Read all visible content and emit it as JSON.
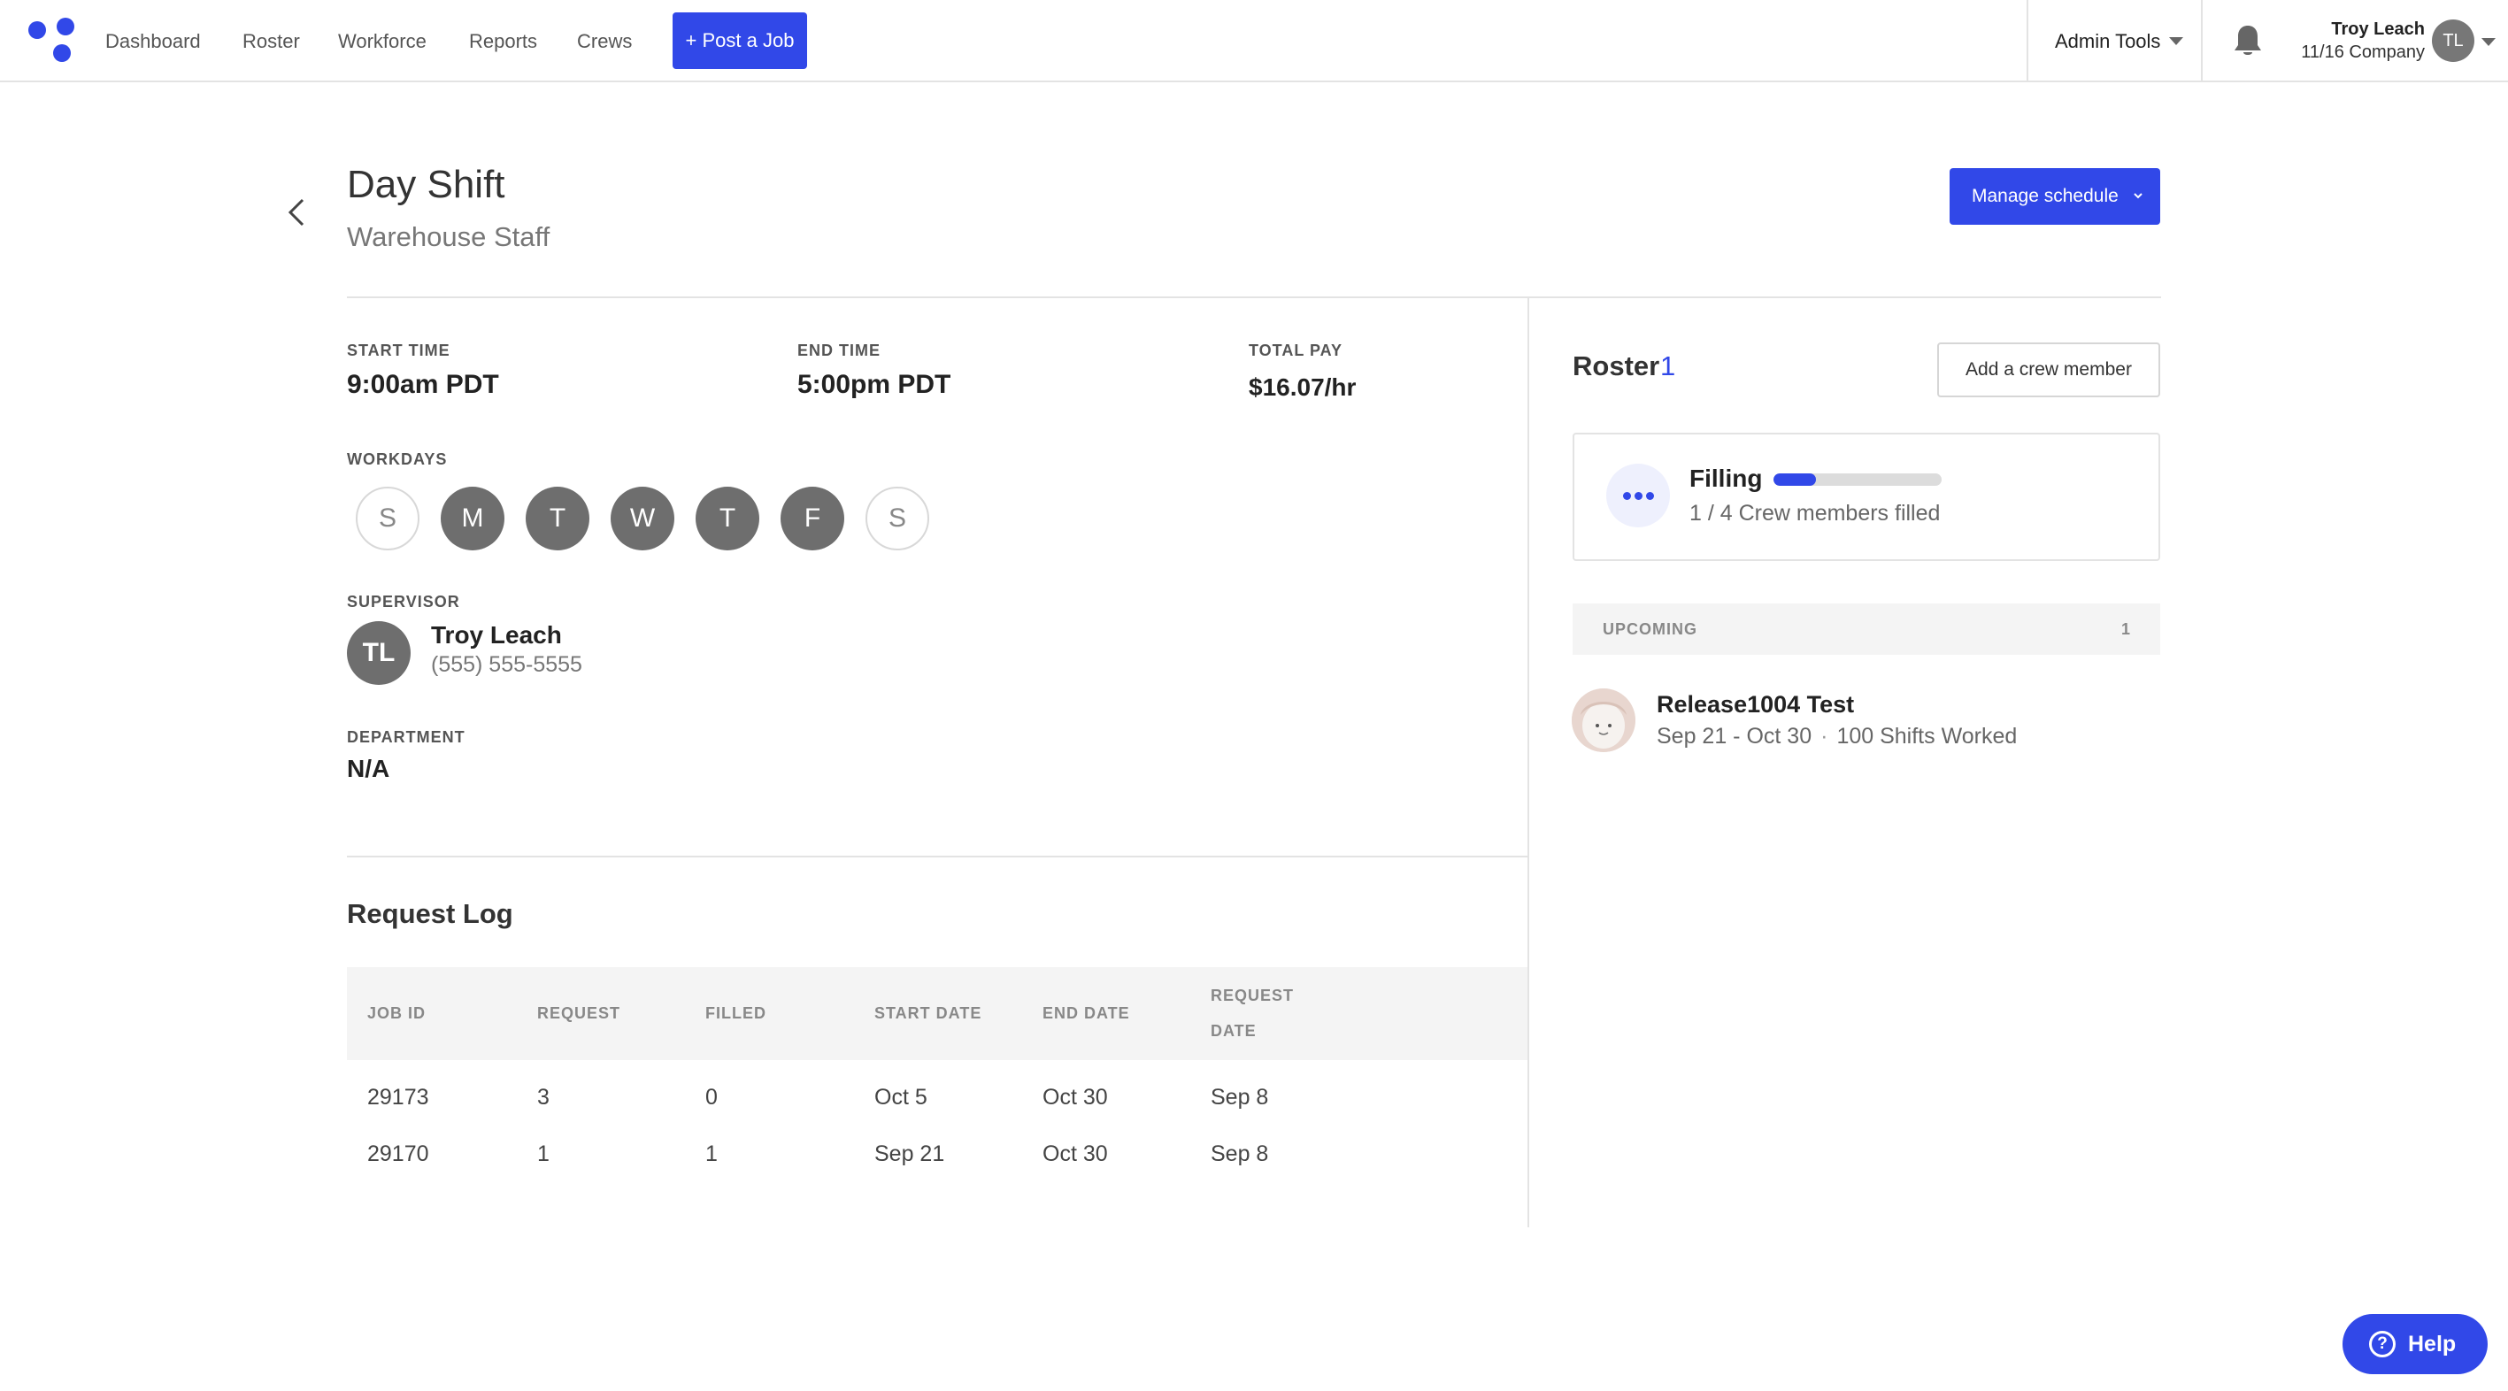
{
  "nav": {
    "links": [
      "Dashboard",
      "Roster",
      "Workforce",
      "Reports",
      "Crews"
    ],
    "post_job": "+ Post a Job",
    "admin_tools": "Admin Tools",
    "user_name": "Troy Leach",
    "user_company": "11/16 Company",
    "user_initials": "TL"
  },
  "header": {
    "title": "Day Shift",
    "subtitle": "Warehouse Staff",
    "manage_schedule": "Manage schedule"
  },
  "details": {
    "start_time_label": "START TIME",
    "start_time": "9:00am PDT",
    "end_time_label": "END TIME",
    "end_time": "5:00pm PDT",
    "total_pay_label": "TOTAL PAY",
    "total_pay": "$16.07/hr",
    "workdays_label": "WORKDAYS",
    "workdays": [
      {
        "letter": "S",
        "active": false
      },
      {
        "letter": "M",
        "active": true
      },
      {
        "letter": "T",
        "active": true
      },
      {
        "letter": "W",
        "active": true
      },
      {
        "letter": "T",
        "active": true
      },
      {
        "letter": "F",
        "active": true
      },
      {
        "letter": "S",
        "active": false
      }
    ],
    "supervisor_label": "SUPERVISOR",
    "supervisor_initials": "TL",
    "supervisor_name": "Troy Leach",
    "supervisor_phone": "(555) 555-5555",
    "department_label": "DEPARTMENT",
    "department": "N/A"
  },
  "request_log": {
    "title": "Request Log",
    "columns": [
      "JOB ID",
      "REQUEST",
      "FILLED",
      "START DATE",
      "END DATE",
      "REQUEST DATE"
    ],
    "rows": [
      [
        "29173",
        "3",
        "0",
        "Oct 5",
        "Oct 30",
        "Sep 8"
      ],
      [
        "29170",
        "1",
        "1",
        "Sep 21",
        "Oct 30",
        "Sep 8"
      ]
    ]
  },
  "roster": {
    "title": "Roster",
    "count": "1",
    "add_crew": "Add a crew member",
    "status": "Filling",
    "filled_fraction": 0.25,
    "filled_text": "1 / 4 Crew members filled",
    "upcoming_label": "UPCOMING",
    "upcoming_count": "1",
    "worker_name": "Release1004 Test",
    "worker_dates": "Sep 21 - Oct 30",
    "worker_shifts": "100 Shifts Worked"
  },
  "help": {
    "label": "Help"
  },
  "colors": {
    "accent": "#3148e8",
    "day_active": "#6e6e6e",
    "divider": "#e3e3e3"
  }
}
